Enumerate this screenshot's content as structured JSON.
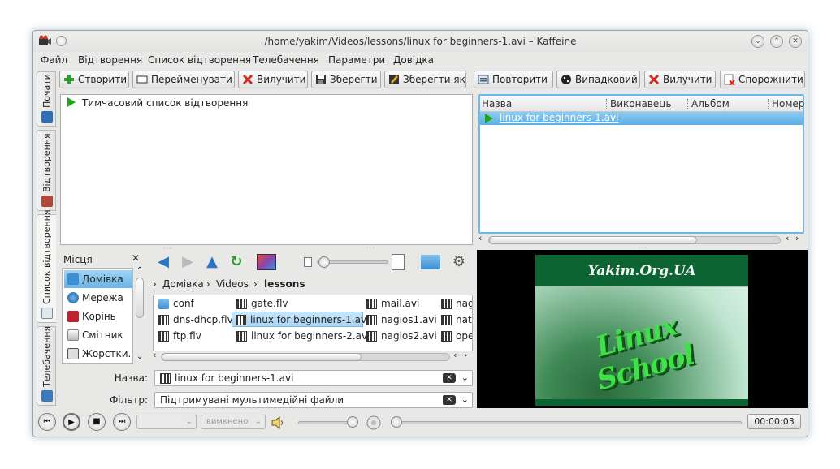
{
  "window": {
    "title": "/home/yakim/Videos/lessons/linux for beginners-1.avi – Kaffeine"
  },
  "menubar": [
    "Файл",
    "Відтворення",
    "Список відтворення",
    "Телебачення",
    "Параметри",
    "Довідка"
  ],
  "sidetabs": [
    "Почати",
    "Відтворення",
    "Список відтворення",
    "Телебачення"
  ],
  "toolbar": {
    "create": "Створити",
    "rename": "Перейменувати",
    "remove": "Вилучити",
    "save": "Зберегти",
    "save_as": "Зберегти як",
    "repeat": "Повторити",
    "random": "Випадковий",
    "remove2": "Вилучити",
    "clear": "Спорожнити"
  },
  "playlist_tree": {
    "item": "Тимчасовий список відтворення"
  },
  "playlist_table": {
    "columns": [
      "Назва",
      "Виконавець",
      "Альбом",
      "Номер"
    ],
    "rows": [
      {
        "title": "linux for beginners-1.avi"
      }
    ]
  },
  "places": {
    "header": "Місця",
    "items": [
      "Домівка",
      "Мережа",
      "Корінь",
      "Смітник",
      "Жорстки..."
    ]
  },
  "breadcrumb": [
    "Домівка",
    "Videos",
    "lessons"
  ],
  "files": [
    {
      "name": "conf",
      "type": "folder"
    },
    {
      "name": "dns-dhcp.flv",
      "type": "video"
    },
    {
      "name": "ftp.flv",
      "type": "video"
    },
    {
      "name": "gate.flv",
      "type": "video"
    },
    {
      "name": "linux for beginners-1.avi",
      "type": "video",
      "selected": true
    },
    {
      "name": "linux for beginners-2.avi",
      "type": "video"
    },
    {
      "name": "mail.avi",
      "type": "video"
    },
    {
      "name": "nagios1.avi",
      "type": "video"
    },
    {
      "name": "nagios2.avi",
      "type": "video"
    },
    {
      "name": "nag",
      "type": "video"
    },
    {
      "name": "nat.",
      "type": "video"
    },
    {
      "name": "ope",
      "type": "video"
    }
  ],
  "form": {
    "name_label": "Назва:",
    "name_value": "linux for beginners-1.avi",
    "filter_label": "Фільтр:",
    "filter_value": "Підтримувані мультимедійні файли"
  },
  "video": {
    "heading": "Yakim.Org.UA",
    "logo_text": "Linux School"
  },
  "controls": {
    "audio_combo": "",
    "subtitle_combo": "вимкнено",
    "time": "00:00:03"
  },
  "colors": {
    "selection": "#5aaee6",
    "play_green": "#23a41f",
    "video_band": "#0c6432"
  }
}
